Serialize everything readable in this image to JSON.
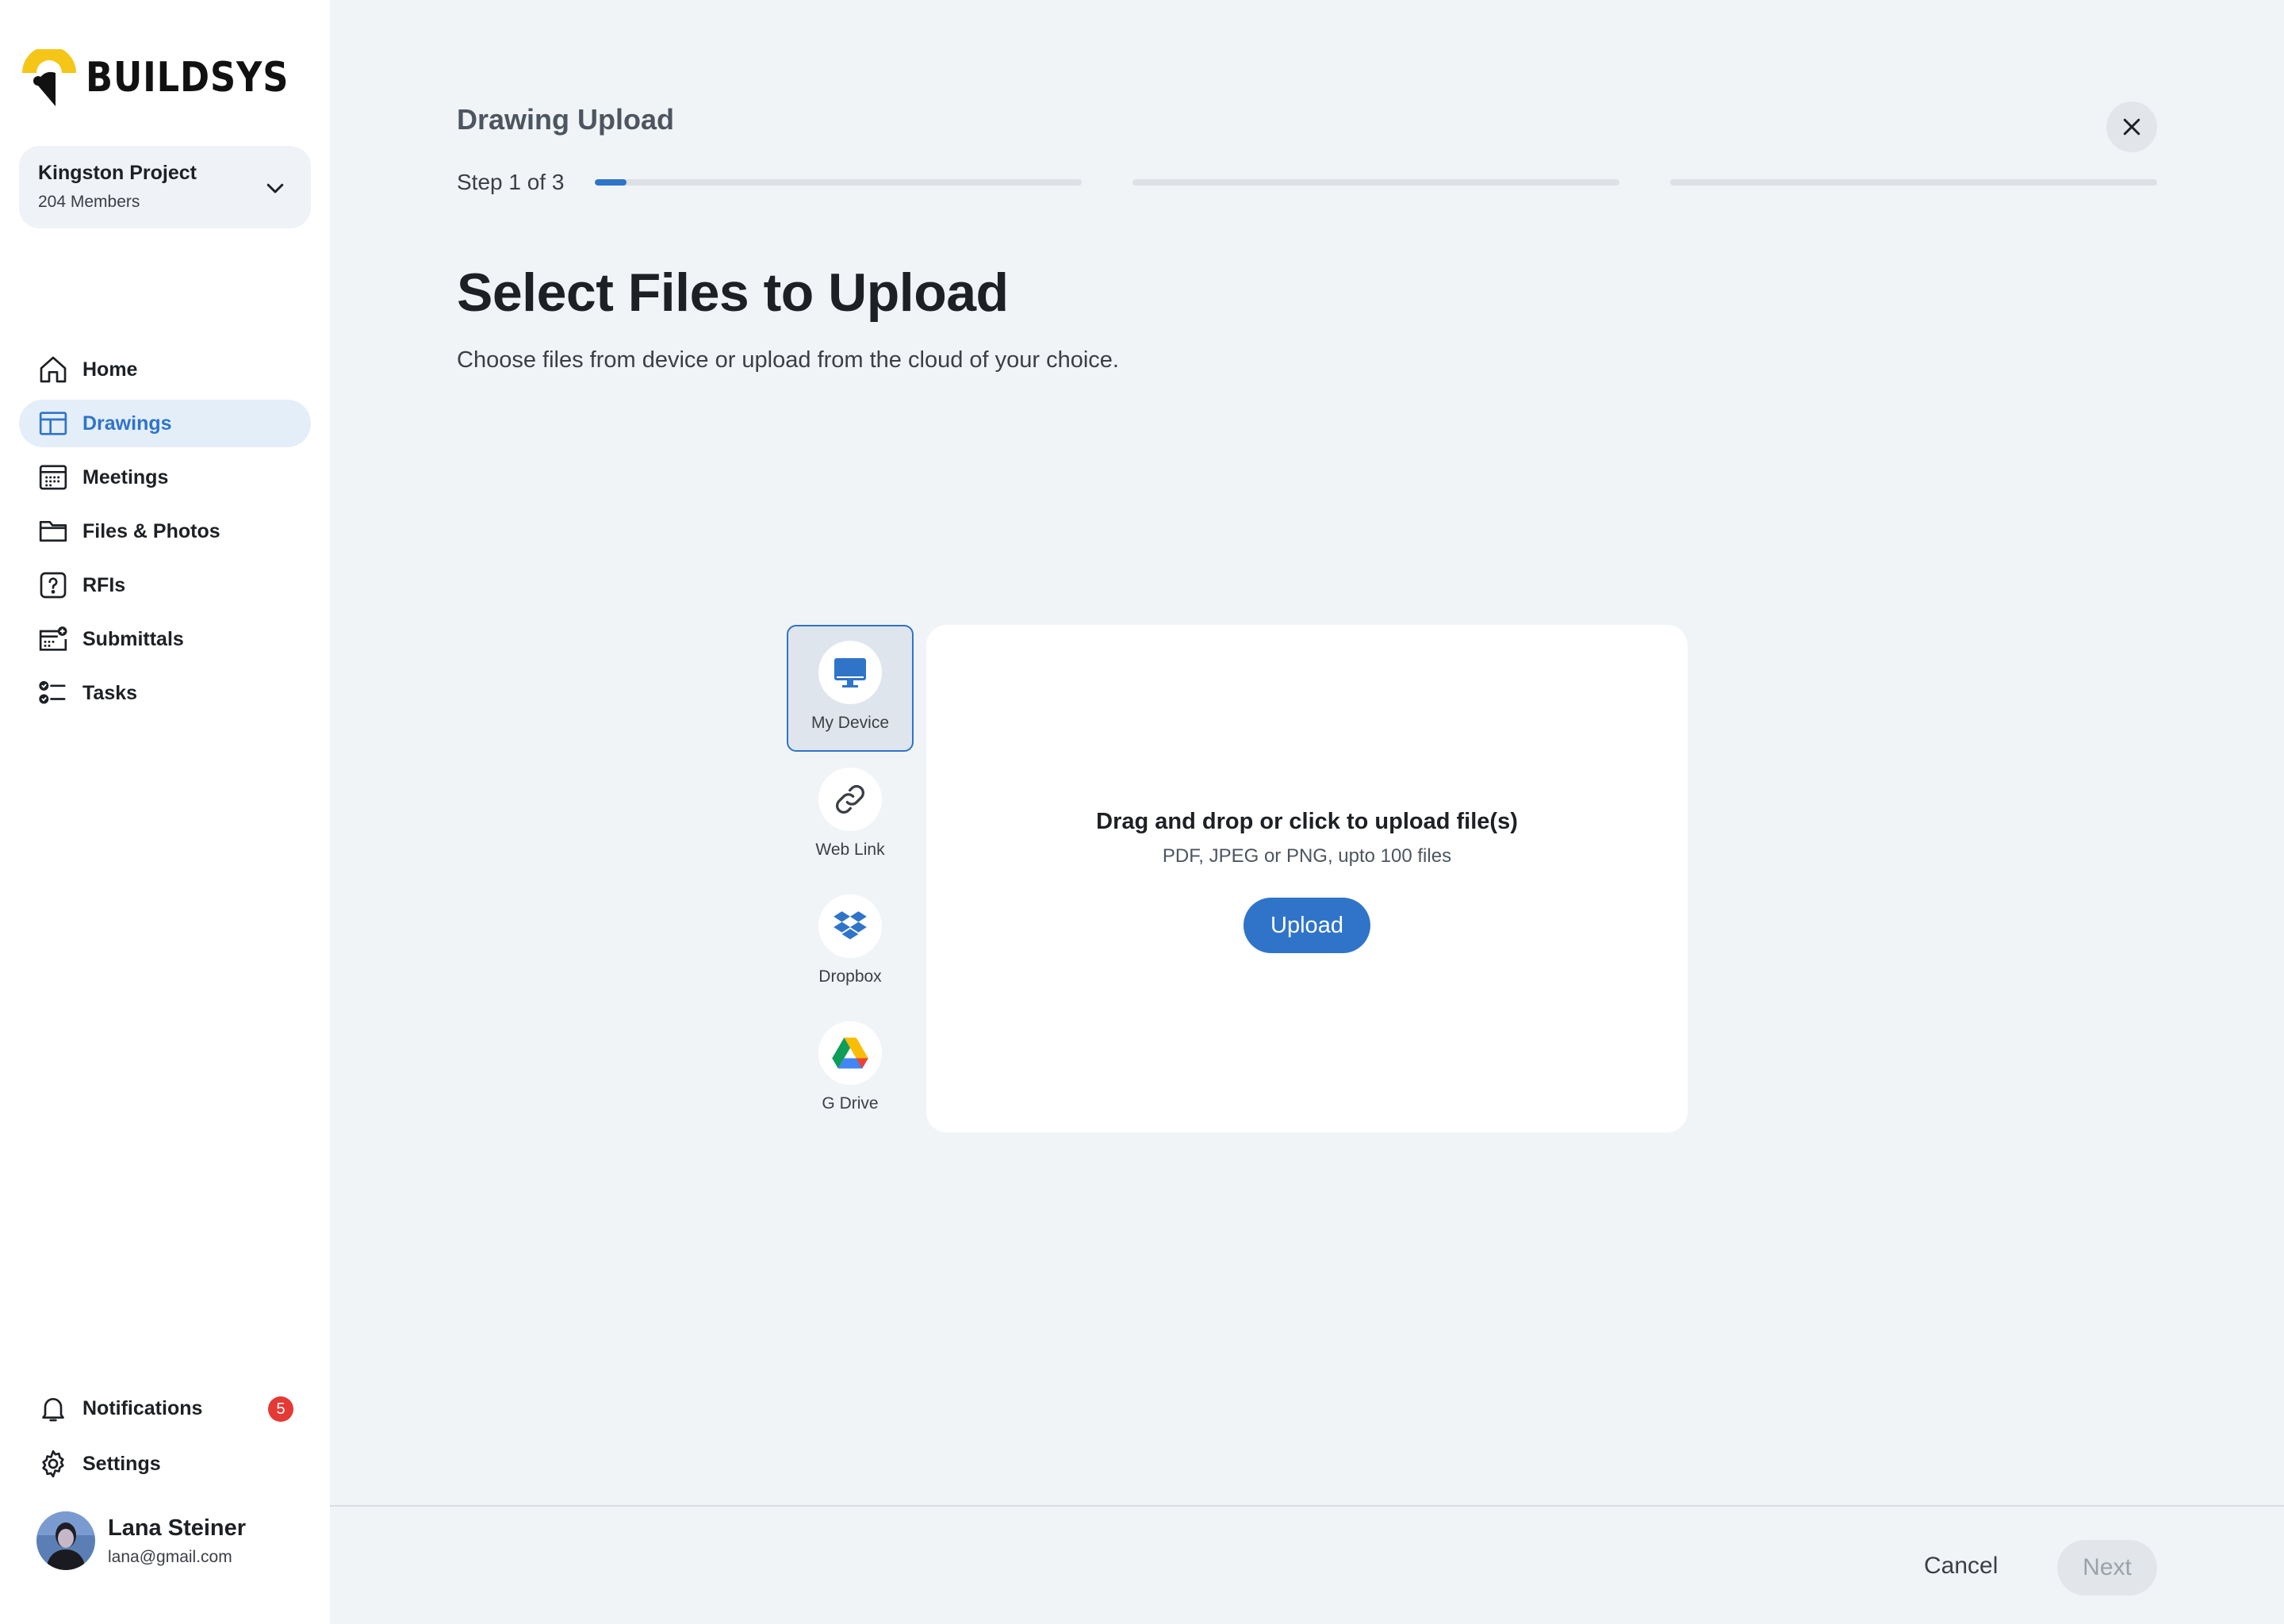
{
  "brand": {
    "name": "BUILDSYS",
    "logo_icon": "buildsys-logo-icon",
    "accent": "#2f74c9",
    "logo_yellow": "#f5c518"
  },
  "project": {
    "name": "Kingston Project",
    "members": "204 Members",
    "chevron_icon": "chevron-down-icon"
  },
  "nav": {
    "items": [
      {
        "label": "Home",
        "icon": "home-icon",
        "active": false
      },
      {
        "label": "Drawings",
        "icon": "drawings-icon",
        "active": true
      },
      {
        "label": "Meetings",
        "icon": "calendar-icon",
        "active": false
      },
      {
        "label": "Files & Photos",
        "icon": "folder-icon",
        "active": false
      },
      {
        "label": "RFIs",
        "icon": "question-icon",
        "active": false
      },
      {
        "label": "Submittals",
        "icon": "submittals-icon",
        "active": false
      },
      {
        "label": "Tasks",
        "icon": "tasks-icon",
        "active": false
      }
    ]
  },
  "notifications": {
    "label": "Notifications",
    "count": "5",
    "icon": "bell-icon",
    "badge_color": "#e53935"
  },
  "settings": {
    "label": "Settings",
    "icon": "gear-icon"
  },
  "user": {
    "name": "Lana Steiner",
    "email": "lana@gmail.com"
  },
  "header": {
    "title": "Drawing Upload",
    "step_label": "Step 1 of 3",
    "close_icon": "close-icon",
    "steps": [
      {
        "progress": 0.065
      },
      {
        "progress": 0
      },
      {
        "progress": 0
      }
    ]
  },
  "main": {
    "title": "Select Files to Upload",
    "subtitle": "Choose files from device or upload from the cloud of your choice."
  },
  "sources": [
    {
      "label": "My Device",
      "icon": "monitor-icon",
      "active": true
    },
    {
      "label": "Web Link",
      "icon": "link-icon",
      "active": false
    },
    {
      "label": "Dropbox",
      "icon": "dropbox-icon",
      "active": false
    },
    {
      "label": "G Drive",
      "icon": "google-drive-icon",
      "active": false
    }
  ],
  "dropzone": {
    "title": "Drag and drop or click to upload file(s)",
    "subtitle": "PDF, JPEG or PNG, upto 100 files",
    "button": "Upload"
  },
  "footer": {
    "cancel": "Cancel",
    "next": "Next"
  }
}
